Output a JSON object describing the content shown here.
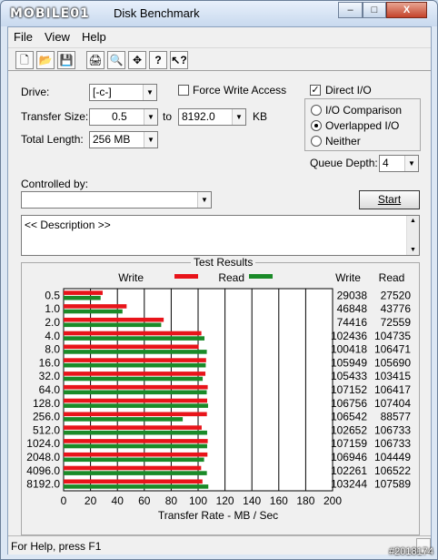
{
  "window": {
    "logo": "MOBILE01",
    "title": "Disk Benchmark",
    "controls": [
      "–",
      "□",
      "X"
    ]
  },
  "menu": [
    "File",
    "View",
    "Help"
  ],
  "toolbar": [
    "new-icon",
    "open-icon",
    "save-icon",
    "print-icon",
    "print-preview-icon",
    "move-icon",
    "help-icon",
    "context-help-icon"
  ],
  "settings": {
    "drive_label": "Drive:",
    "drive_value": "[-c-]",
    "transfer_size_label": "Transfer Size:",
    "transfer_from": "0.5",
    "to_label": "to",
    "transfer_to": "8192.0",
    "kb_label": "KB",
    "total_length_label": "Total Length:",
    "total_length_value": "256 MB",
    "force_write_access_label": "Force Write Access",
    "force_write_access_checked": false,
    "direct_io_label": "Direct I/O",
    "direct_io_checked": true,
    "io_options": [
      {
        "label": "I/O Comparison",
        "selected": false
      },
      {
        "label": "Overlapped I/O",
        "selected": true
      },
      {
        "label": "Neither",
        "selected": false
      }
    ],
    "queue_depth_label": "Queue Depth:",
    "queue_depth_value": "4",
    "controlled_by_label": "Controlled by:",
    "controlled_by_value": "",
    "start_label": "Start"
  },
  "description": "<< Description >>",
  "results": {
    "title": "Test Results",
    "legend_write": "Write",
    "legend_read": "Read",
    "col_write": "Write",
    "col_read": "Read",
    "colors": {
      "write": "#e8141a",
      "read": "#1a8a28"
    }
  },
  "chart_data": {
    "type": "bar",
    "orientation": "horizontal",
    "categories": [
      "0.5",
      "1.0",
      "2.0",
      "4.0",
      "8.0",
      "16.0",
      "32.0",
      "64.0",
      "128.0",
      "256.0",
      "512.0",
      "1024.0",
      "2048.0",
      "4096.0",
      "8192.0"
    ],
    "series": [
      {
        "name": "Write",
        "values": [
          29038,
          46848,
          74416,
          102436,
          100418,
          105949,
          105433,
          107152,
          106756,
          106542,
          102652,
          107159,
          106946,
          102261,
          103244
        ]
      },
      {
        "name": "Read",
        "values": [
          27520,
          43776,
          72559,
          104735,
          106471,
          105690,
          103415,
          106417,
          107404,
          88577,
          106733,
          106733,
          104449,
          106522,
          107589
        ]
      }
    ],
    "xlabel": "Transfer Rate - MB / Sec",
    "xlim": [
      0,
      200
    ],
    "xticks": [
      "0",
      "20",
      "40",
      "60",
      "80",
      "100",
      "120",
      "140",
      "160",
      "180",
      "200"
    ],
    "grid": true
  },
  "status": {
    "text": "For Help, press F1",
    "watermark": "#2018174"
  }
}
